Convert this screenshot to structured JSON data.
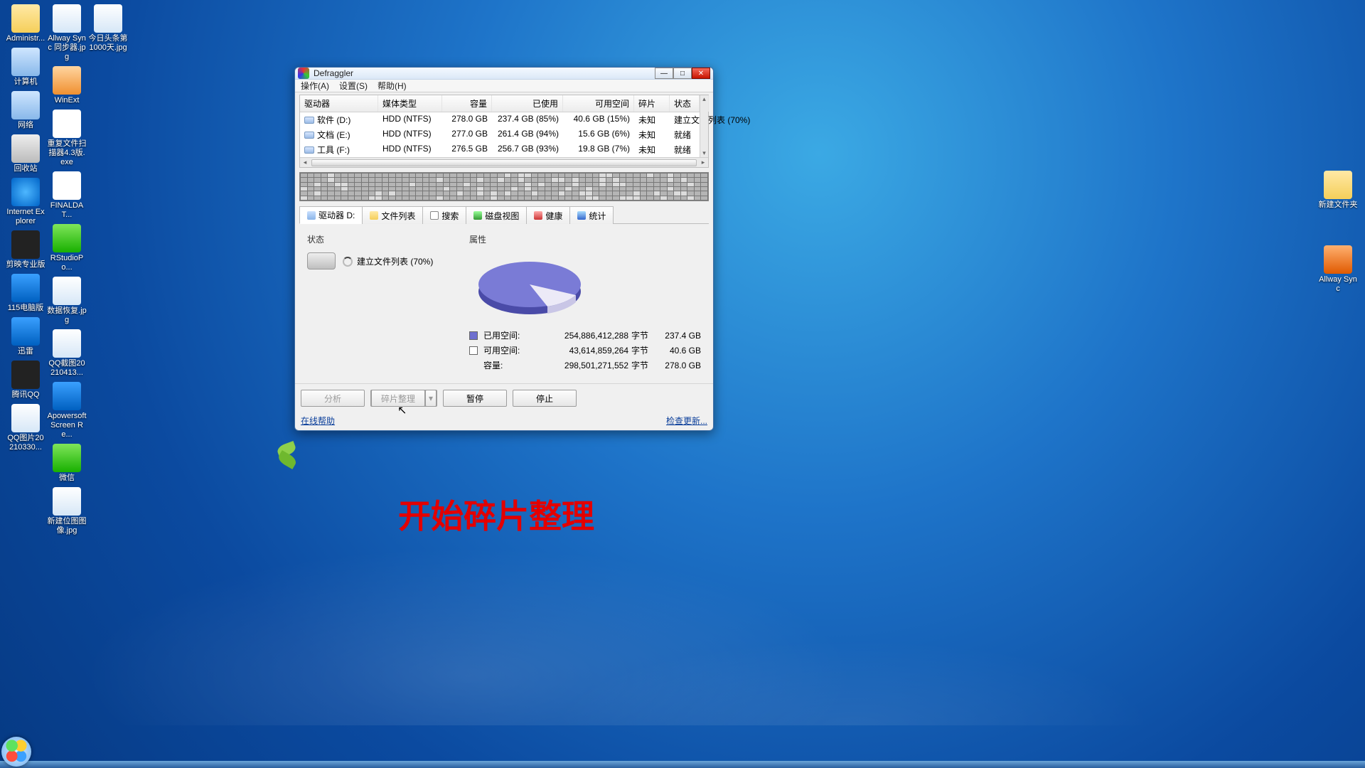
{
  "caption": "开始碎片整理",
  "desktop_icons": {
    "col1": [
      {
        "label": "Administr..."
      },
      {
        "label": "计算机"
      },
      {
        "label": "网络"
      },
      {
        "label": "回收站"
      },
      {
        "label": "Internet Explorer"
      },
      {
        "label": "剪映专业版"
      },
      {
        "label": "115电脑版"
      },
      {
        "label": "迅雷"
      },
      {
        "label": "腾讯QQ"
      },
      {
        "label": "QQ图片20210330..."
      }
    ],
    "col2": [
      {
        "label": "Allway Sync 同步器.jpg"
      },
      {
        "label": "WinExt"
      },
      {
        "label": "重复文件扫描器4.3版.exe"
      },
      {
        "label": "FINALDAT..."
      },
      {
        "label": "RStudioPo..."
      },
      {
        "label": "数据恢复.jpg"
      },
      {
        "label": "QQ截图20210413..."
      },
      {
        "label": "Apowersoft Screen Re..."
      },
      {
        "label": "微信"
      },
      {
        "label": "新建位图图像.jpg"
      }
    ],
    "col3": [
      {
        "label": "今日头条第1000天.jpg"
      }
    ],
    "right": [
      {
        "label": "新建文件夹"
      },
      {
        "label": "Allway Sync"
      }
    ]
  },
  "window": {
    "title": "Defraggler",
    "menu": {
      "action": "操作(A)",
      "settings": "设置(S)",
      "help": "帮助(H)"
    },
    "grid": {
      "headers": {
        "drive": "驱动器",
        "media": "媒体类型",
        "capacity": "容量",
        "used": "已使用",
        "free": "可用空间",
        "frag": "碎片",
        "status": "状态"
      },
      "rows": [
        {
          "name": "软件 (D:)",
          "media": "HDD (NTFS)",
          "cap": "278.0 GB",
          "used": "237.4 GB (85%)",
          "free": "40.6 GB (15%)",
          "frag": "未知",
          "status": "建立文件列表 (70%)"
        },
        {
          "name": "文档 (E:)",
          "media": "HDD (NTFS)",
          "cap": "277.0 GB",
          "used": "261.4 GB (94%)",
          "free": "15.6 GB (6%)",
          "frag": "未知",
          "status": "就绪"
        },
        {
          "name": "工具 (F:)",
          "media": "HDD (NTFS)",
          "cap": "276.5 GB",
          "used": "256.7 GB (93%)",
          "free": "19.8 GB (7%)",
          "frag": "未知",
          "status": "就绪"
        }
      ]
    },
    "tabs": {
      "drive": "驱动器 D:",
      "files": "文件列表",
      "search": "搜索",
      "diskmap": "磁盘视图",
      "health": "健康",
      "stats": "统计"
    },
    "status_panel": {
      "title": "状态",
      "msg": "建立文件列表 (70%)"
    },
    "prop_panel": {
      "title": "属性",
      "used_label": "已用空间:",
      "free_label": "可用空间:",
      "cap_label": "容量:",
      "used_bytes": "254,886,412,288",
      "free_bytes": "43,614,859,264",
      "cap_bytes": "298,501,271,552",
      "bytes_unit": "字节",
      "used_gb": "237.4 GB",
      "free_gb": "40.6 GB",
      "cap_gb": "278.0 GB"
    },
    "buttons": {
      "analyze": "分析",
      "defrag": "碎片整理",
      "pause": "暂停",
      "stop": "停止"
    },
    "links": {
      "online_help": "在线帮助",
      "check_update": "检查更新..."
    }
  },
  "chart_data": {
    "type": "pie",
    "title": "",
    "series": [
      {
        "name": "已用空间",
        "value": 254886412288,
        "value_gb": 237.4,
        "color": "#6e6fcf"
      },
      {
        "name": "可用空间",
        "value": 43614859264,
        "value_gb": 40.6,
        "color": "#e8e8f2"
      }
    ],
    "total": {
      "name": "容量",
      "value": 298501271552,
      "value_gb": 278.0
    }
  }
}
